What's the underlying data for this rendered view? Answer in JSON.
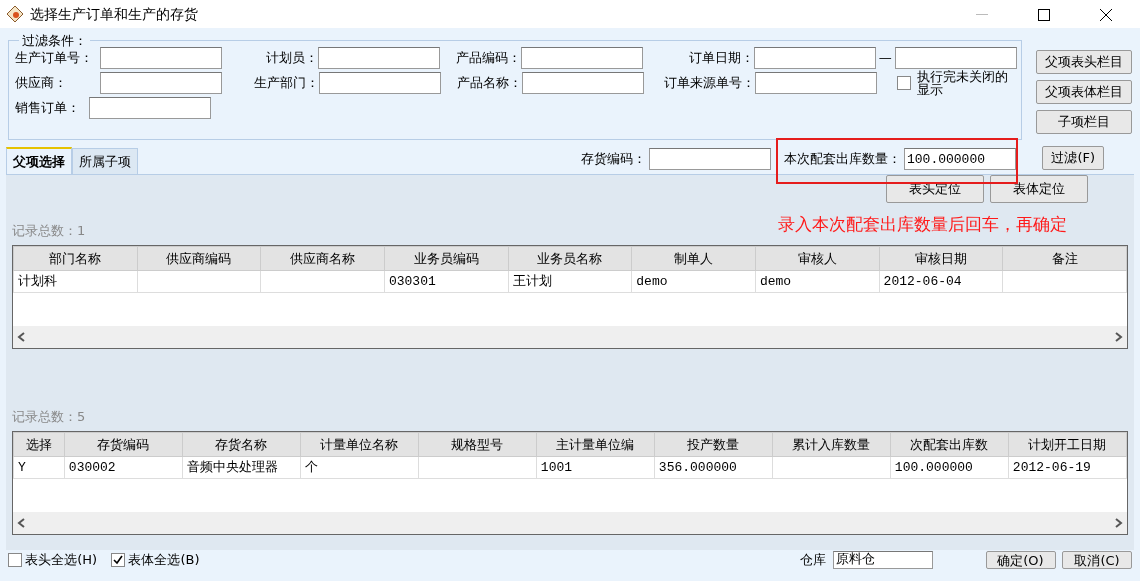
{
  "window": {
    "title": "选择生产订单和生产的存货"
  },
  "filter": {
    "legend": "过滤条件：",
    "rows": [
      [
        {
          "kind": "field",
          "label": "生产订单号："
        },
        {
          "kind": "field",
          "label": "计划员："
        },
        {
          "kind": "field",
          "label": "产品编码："
        },
        {
          "kind": "range",
          "label": "订单日期：",
          "separator": "—"
        }
      ],
      [
        {
          "kind": "field",
          "label": "供应商："
        },
        {
          "kind": "field",
          "label": "生产部门："
        },
        {
          "kind": "field",
          "label": "产品名称："
        },
        {
          "kind": "field",
          "label": "订单来源单号："
        },
        {
          "kind": "check",
          "label": "执行完未关闭的显示",
          "checked": false
        }
      ],
      [
        {
          "kind": "field",
          "label": "销售订单："
        }
      ]
    ]
  },
  "side_buttons": [
    "父项表头栏目",
    "父项表体栏目",
    "子项栏目"
  ],
  "tabs": [
    {
      "label": "父项选择",
      "selected": true
    },
    {
      "label": "所属子项",
      "selected": false
    }
  ],
  "inventory_code": {
    "label": "存货编码："
  },
  "quantity": {
    "label": "本次配套出库数量：",
    "value": "100.000000"
  },
  "filter_button": "过滤(F)",
  "locate_buttons": [
    "表头定位",
    "表体定位"
  ],
  "annotation": "录入本次配套出库数量后回车，再确定",
  "grids": [
    {
      "count": "记录总数：1",
      "columns": [
        "部门名称",
        "供应商编码",
        "供应商名称",
        "业务员编码",
        "业务员名称",
        "制单人",
        "审核人",
        "审核日期",
        "备注"
      ],
      "rows": [
        [
          "计划科",
          "",
          "",
          "030301",
          "王计划",
          "demo",
          "demo",
          "2012-06-04",
          ""
        ]
      ]
    },
    {
      "count": "记录总数：5",
      "columns": [
        "选择",
        "存货编码",
        "存货名称",
        "计量单位名称",
        "规格型号",
        "主计量单位编",
        "投产数量",
        "累计入库数量",
        "次配套出库数",
        "计划开工日期"
      ],
      "rows": [
        [
          "Y",
          "030002",
          "音频中央处理器",
          "个",
          "",
          "1001",
          "356.000000",
          "",
          "100.000000",
          "2012-06-19"
        ]
      ]
    }
  ],
  "bottom": {
    "checks": [
      {
        "label": "表头全选(H)",
        "checked": false
      },
      {
        "label": "表体全选(B)",
        "checked": true
      }
    ],
    "warehouse": {
      "label": "仓库",
      "value": "原料仓"
    },
    "buttons": [
      "确定(O)",
      "取消(C)"
    ]
  }
}
